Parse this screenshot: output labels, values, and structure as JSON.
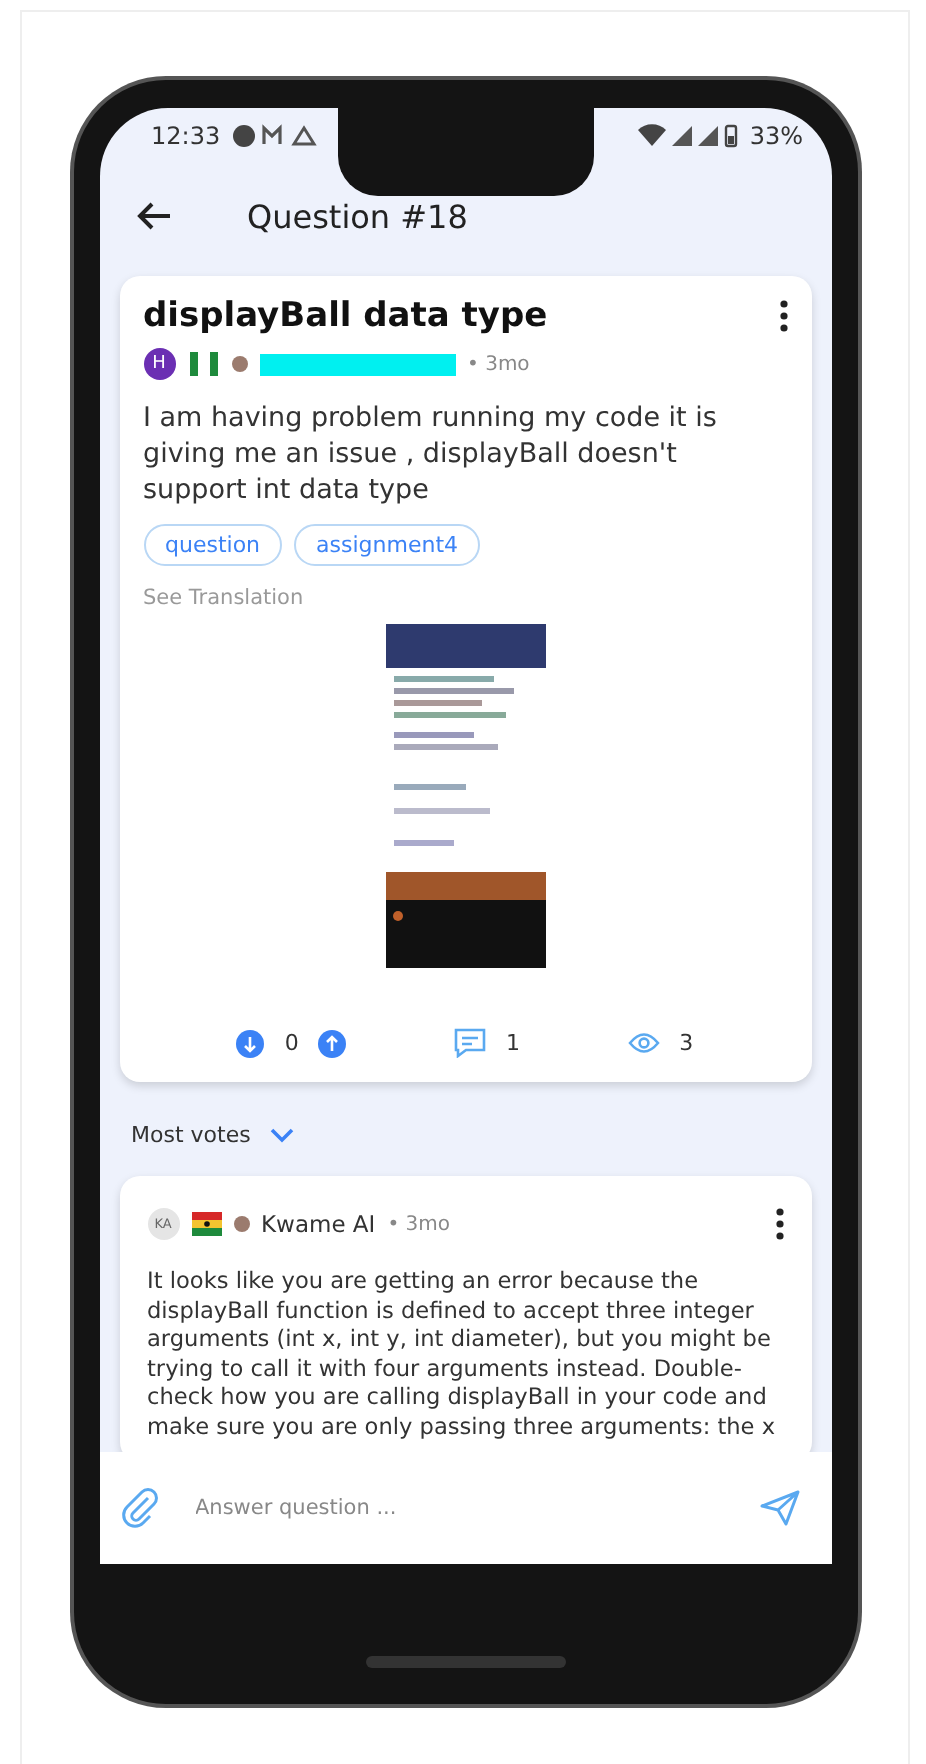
{
  "status_bar": {
    "time": "12:33",
    "battery": "33%"
  },
  "header": {
    "title": "Question #18"
  },
  "question": {
    "title": "displayBall data type",
    "author_initial": "H",
    "time": "• 3mo",
    "body": "I am having problem running my code it is giving me an issue , displayBall doesn't support int data type",
    "tags": [
      {
        "label": "question"
      },
      {
        "label": "assignment4"
      }
    ],
    "translation_link": "See Translation",
    "votes": "0",
    "comments": "1",
    "views": "3"
  },
  "sort": {
    "label": "Most votes"
  },
  "answers": [
    {
      "avatar": "KA",
      "author": "Kwame AI",
      "time": "• 3mo",
      "body": "It looks like you are getting an error because the displayBall function is defined to accept three integer arguments (int x, int y, int diameter), but you might be trying to call it with four arguments instead. Double-check how you are calling displayBall in your code and make sure you are only passing three arguments: the x"
    }
  ],
  "composer": {
    "placeholder": "Answer question ..."
  }
}
